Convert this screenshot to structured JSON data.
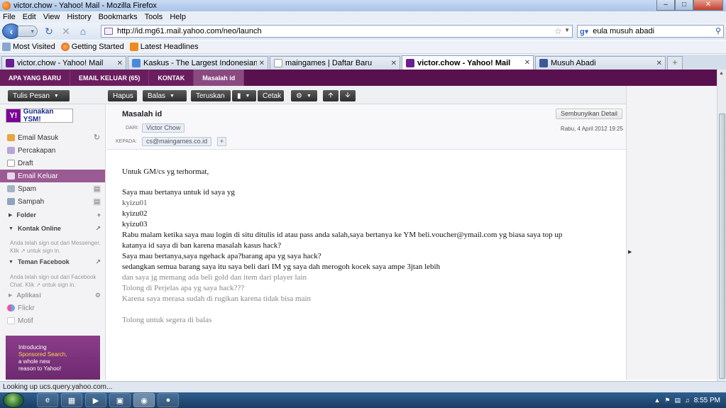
{
  "window": {
    "title": "victor.chow - Yahoo! Mail - Mozilla Firefox"
  },
  "menu": [
    "File",
    "Edit",
    "View",
    "History",
    "Bookmarks",
    "Tools",
    "Help"
  ],
  "nav": {
    "url": "http://id.mg61.mail.yahoo.com/neo/launch",
    "search": "eula musuh abadi"
  },
  "bookmarks": [
    "Most Visited",
    "Getting Started",
    "Latest Headlines"
  ],
  "tabs": [
    {
      "label": "victor.chow - Yahoo! Mail"
    },
    {
      "label": "Kaskus - The Largest Indonesian Co..."
    },
    {
      "label": "maingames | Daftar Baru"
    },
    {
      "label": "victor.chow - Yahoo! Mail"
    },
    {
      "label": "Musuh Abadi"
    }
  ],
  "ymail_tabs": [
    "APA YANG BARU",
    "EMAIL KELUAR (65)",
    "KONTAK",
    "Masalah id"
  ],
  "toolbar": {
    "compose": "Tulis Pesan",
    "delete": "Hapus",
    "reply": "Balas",
    "forward": "Teruskan",
    "print": "Cetak"
  },
  "sidebar": {
    "ysm": "Gunakan YSM!",
    "inbox": "Email Masuk",
    "conversations": "Percakapan",
    "draft": "Draft",
    "sent": "Email Keluar",
    "spam": "Spam",
    "trash": "Sampah",
    "folders": "Folder",
    "contacts_online": "Kontak Online",
    "messenger_note": "Anda telah sign out dari Messenger. Klik  ↗  untuk sign in.",
    "facebook_friends": "Teman Facebook",
    "facebook_note": "Anda telah sign out dari Facebook Chat. Klik  ↗  untuk sign in.",
    "apps": "Aplikasi",
    "flickr": "Flickr",
    "motif": "Motif",
    "promo": [
      "Introducing",
      "Sponsored Search,",
      "a whole new",
      "reason to Yahoo!"
    ]
  },
  "message": {
    "subject": "Masalah id",
    "hide_details": "Sembunyikan Detail",
    "from_label": "DARI:",
    "from": "Victor Chow",
    "to_label": "KEPADA:",
    "to": "cs@maingames.co.id",
    "date": "Rabu, 4 April 2012 19:25",
    "body": [
      "Untuk GM/cs yg terhormat,",
      "Saya mau bertanya untuk id saya yg",
      "kyizu01",
      "kyizu02",
      "kyizu03",
      "Rabu malam ketika saya mau login di situ ditulis id atau pass anda salah,saya bertanya ke YM beli.voucher@ymail.com yg biasa saya top up",
      "katanya id saya di ban karena masalah kasus hack?",
      "Saya mau bertanya,saya ngehack apa?barang apa yg saya hack?",
      "sedangkan semua barang saya itu saya beli dari IM yg saya dah merogoh kocek saya ampe 3jtan lebih",
      "dan saya jg memang ada beli gold dan item dari player lain",
      "Tolong di Perjelas apa yg saya hack???",
      "Karena saya merasa sudah di rugikan karena tidak bisa main",
      "Tolong untuk segera di balas"
    ]
  },
  "status": "Looking up ucs.query.yahoo.com...",
  "clock": "8:55 PM"
}
